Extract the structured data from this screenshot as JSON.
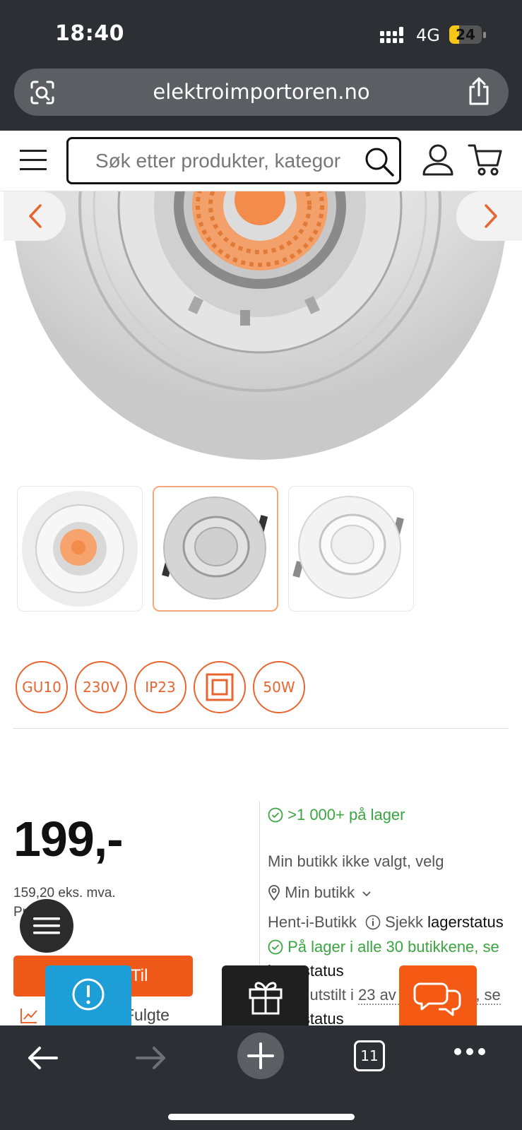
{
  "status_bar": {
    "time": "18:40",
    "network": "4G",
    "battery": "24"
  },
  "browser": {
    "url": "elektroimportoren.no",
    "tab_count": "11"
  },
  "header": {
    "search_placeholder": "Søk etter produkter, kategor"
  },
  "product": {
    "specs": [
      "GU10",
      "230V",
      "IP23",
      "double-insulation-icon",
      "50W"
    ],
    "price": "199,-",
    "price_ex_vat": "159,20 eks. mva.",
    "unit": "Pr. Stykk",
    "checkout_label": "Til kasse",
    "followed_label": "Fulgte"
  },
  "stock": {
    "online": ">1 000+ på lager",
    "store_not_selected": "Min butikk ikke valgt, velg",
    "my_store": "Min butikk",
    "pickup_label": "Hent-i-Butikk",
    "check_label": "Sjekk",
    "status_link": "lagerstatus",
    "all_stores": "På lager i alle 30 butikkene, se",
    "all_stores_link": "lagerstatus",
    "displayed_prefix": "Vises utstilt i",
    "displayed_link": "23 av 30 butikker, se",
    "displayed_link2": "lagerstatus"
  },
  "colors": {
    "accent": "#e9652f",
    "in_stock": "#3aa640",
    "chrome": "#2c2f33"
  }
}
